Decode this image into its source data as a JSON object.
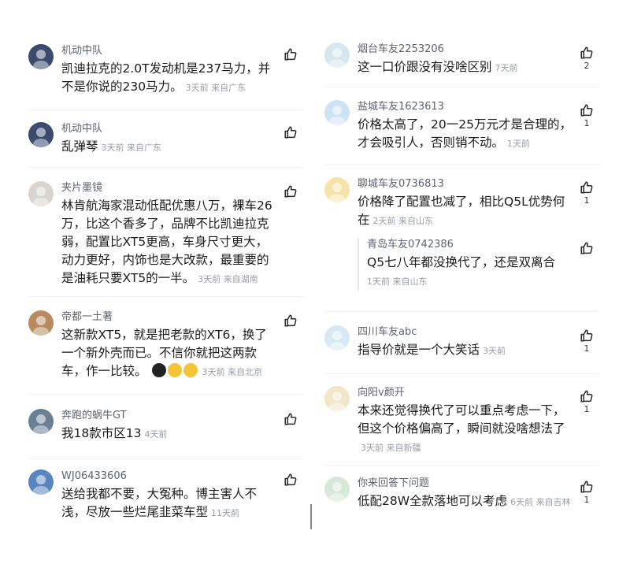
{
  "left": [
    {
      "user": "机动中队",
      "lines": [
        "凯迪拉克的2.0T发动机是237马力，并",
        "不是你说的230马力。"
      ],
      "time": "3天前",
      "loc": "来自广东",
      "likes": ""
    },
    {
      "user": "机动中队",
      "lines": [
        "乱弹琴"
      ],
      "time": "3天前",
      "loc": "来自广东",
      "likes": ""
    },
    {
      "user": "夹片墨镜",
      "lines": [
        "林肯航海家混动低配优惠八万，裸车26",
        "万，比这个香多了，品牌不比凯迪拉克",
        "弱，配置比XT5更高，车身尺寸更大，",
        "动力更好，内饰也是大改款，最重要的",
        "是油耗只要XT5的一半。"
      ],
      "time": "3天前",
      "loc": "来自湖南",
      "likes": ""
    },
    {
      "user": "帝都一土著",
      "lines": [
        "这新款XT5，就是把老款的XT6，换了",
        "一个新外壳而已。不信你就把这两款",
        "车，作一比较。"
      ],
      "time": "3天前",
      "loc": "来自北京",
      "likes": ""
    },
    {
      "user": "奔跑的蜗牛GT",
      "lines": [
        "我18款市区13"
      ],
      "time": "4天前",
      "loc": "",
      "likes": ""
    },
    {
      "user": "WJ06433606",
      "lines": [
        "送给我都不要，大冤种。博主害人不",
        "浅，尽放一些烂尾韭菜车型"
      ],
      "time": "11天前",
      "loc": "",
      "likes": ""
    }
  ],
  "right": [
    {
      "user": "烟台车友2253206",
      "lines": [
        "这一口价跟没有没啥区别"
      ],
      "time": "7天前",
      "loc": "",
      "likes": "2"
    },
    {
      "user": "盐城车友1623613",
      "lines": [
        "价格太高了，20一25万元才是合理的，",
        "才会吸引人，否则销不动。"
      ],
      "time": "1天前",
      "loc": "",
      "likes": "1"
    },
    {
      "user": "聊城车友0736813",
      "lines": [
        "价格降了配置也减了，相比Q5L优势何",
        "在"
      ],
      "time": "2天前",
      "loc": "来自山东",
      "likes": "1"
    },
    {
      "user": "四川车友abc",
      "lines": [
        "指导价就是一个大笑话"
      ],
      "time": "3天前",
      "loc": "",
      "likes": "1"
    },
    {
      "user": "向阳v颜开",
      "lines": [
        "本来还觉得换代了可以重点考虑一下，",
        "但这个价格偏高了，瞬间就没啥想法了"
      ],
      "time": "3天前",
      "loc": "来自新疆",
      "likes": "1"
    },
    {
      "user": "你来回答下问题",
      "lines": [
        "低配28W全款落地可以考虑"
      ],
      "time": "6天前",
      "loc": "来自吉林",
      "likes": "1"
    }
  ],
  "reply": {
    "user": "青岛车友0742386",
    "lines": [
      "Q5七八年都没换代了，还是双离合"
    ],
    "time": "1天前",
    "loc": "来自山东",
    "likes": ""
  },
  "icons": {
    "like": "thumbs-up-icon",
    "emoji": [
      "sad-face-icon",
      "worried-face-icon",
      "grin-face-icon"
    ]
  }
}
